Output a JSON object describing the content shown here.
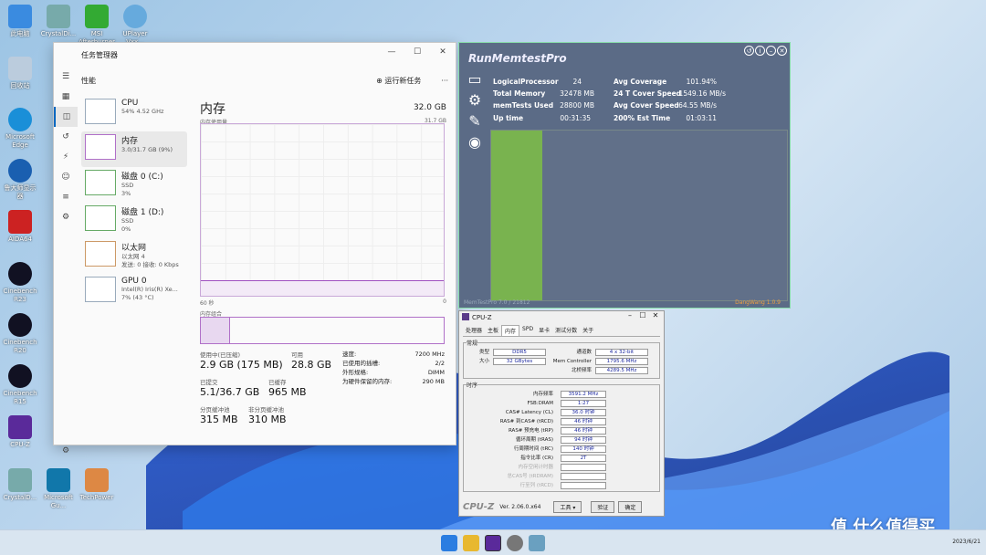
{
  "desktop": {
    "icons": [
      {
        "label": "此电脑",
        "color": "#3a8be0"
      },
      {
        "label": "CrystalDi...",
        "color": "#7aa"
      },
      {
        "label": "MSI\nAfterburner",
        "color": "#3a3"
      },
      {
        "label": "UPlayer\nVxx...",
        "color": "#6ad"
      },
      {
        "label": "回收站",
        "color": "#bcd"
      },
      {
        "label": "Microsoft\nEdge",
        "color": "#1a8fd8"
      },
      {
        "label": "鲁大师显示\n器",
        "color": "#1a5fb0"
      },
      {
        "label": "AIDA64",
        "color": "#c22"
      },
      {
        "label": "Cinebench\nR23",
        "color": "#112"
      },
      {
        "label": "Cinebench\nR20",
        "color": "#112"
      },
      {
        "label": "Cinebench\nR15",
        "color": "#112"
      },
      {
        "label": "CPU-Z",
        "color": "#5a2a9a"
      },
      {
        "label": "CrystalD...",
        "color": "#7aa"
      },
      {
        "label": "Microsoft\nGu...",
        "color": "#17a"
      },
      {
        "label": "TechPower",
        "color": "#d84"
      }
    ]
  },
  "taskmanager": {
    "title": "任务管理器",
    "section": "性能",
    "run_task": "运行新任务",
    "more": "···",
    "items": [
      {
        "name": "CPU",
        "l1": "54% 4.52 GHz",
        "l2": ""
      },
      {
        "name": "内存",
        "l1": "3.0/31.7 GB (9%)",
        "l2": ""
      },
      {
        "name": "磁盘 0 (C:)",
        "l1": "SSD",
        "l2": "3%"
      },
      {
        "name": "磁盘 1 (D:)",
        "l1": "SSD",
        "l2": "0%"
      },
      {
        "name": "以太网",
        "l1": "以太网 4",
        "l2": "发送: 0 接收: 0 Kbps"
      },
      {
        "name": "GPU 0",
        "l1": "Intel(R) Iris(R) Xe...",
        "l2": "7% (43 °C)"
      }
    ],
    "main": {
      "title": "内存",
      "capacity": "32.0 GB",
      "usage_label": "内存使用量",
      "usage_max": "31.7 GB",
      "time_left": "60 秒",
      "time_right": "0",
      "composition_label": "内存组合",
      "usage_fraction": 0.09,
      "composition_used_fraction": 0.12,
      "stats": {
        "in_use_label": "使用中(已压缩)",
        "in_use": "2.9 GB (175 MB)",
        "available_label": "可用",
        "available": "28.8 GB",
        "committed_label": "已提交",
        "committed": "5.1/36.7 GB",
        "cached_label": "已缓存",
        "cached": "965 MB",
        "paged_label": "分页缓冲池",
        "paged": "315 MB",
        "nonpaged_label": "非分页缓冲池",
        "nonpaged": "310 MB"
      },
      "specs": [
        {
          "k": "速度:",
          "v": "7200 MHz"
        },
        {
          "k": "已使用的插槽:",
          "v": "2/2"
        },
        {
          "k": "外形规格:",
          "v": "DIMM"
        },
        {
          "k": "为硬件保留的内存:",
          "v": "290 MB"
        }
      ]
    }
  },
  "runmemtest": {
    "title": "RunMemtestPro",
    "left": [
      {
        "k": "LogicalProcessor",
        "v": "24"
      },
      {
        "k": "Total Memory",
        "v": "32478 MB"
      },
      {
        "k": "memTests Used",
        "v": "28800 MB"
      },
      {
        "k": "Up time",
        "v": "00:31:35"
      }
    ],
    "right": [
      {
        "k": "Avg Coverage",
        "v": "101.94%"
      },
      {
        "k": "24 T Cover Speed",
        "v": "1549.16 MB/s"
      },
      {
        "k": "Avg Cover Speed",
        "v": "64.55 MB/s"
      },
      {
        "k": "200% Est Time",
        "v": "01:03:11"
      }
    ],
    "footer_left": "MemTestPro 7.0 / 21812",
    "footer_right": "DangWang 1.0.9",
    "bar_color": "#79b34f"
  },
  "cpuz": {
    "title": "CPU-Z",
    "tabs": [
      "处理器",
      "主板",
      "内存",
      "SPD",
      "显卡",
      "测试分数",
      "关于"
    ],
    "active_tab": "内存",
    "general_label": "常规",
    "type_k": "类型",
    "type_v": "DDR5",
    "size_k": "大小",
    "size_v": "32 GBytes",
    "channel_k": "通道数",
    "channel_v": "4 x 32-bit",
    "mc_k": "Mem Controller",
    "mc_v": "1795.6 MHz",
    "nb_k": "北桥频率",
    "nb_v": "4289.5 MHz",
    "timing_label": "时序",
    "timings": [
      {
        "k": "内存频率",
        "v": "3591.2 MHz",
        "grey": false
      },
      {
        "k": "FSB:DRAM",
        "v": "1:27",
        "grey": false
      },
      {
        "k": "CAS# Latency (CL)",
        "v": "36.0 时钟",
        "grey": false
      },
      {
        "k": "RAS# 到CAS# (tRCD)",
        "v": "46 时钟",
        "grey": false
      },
      {
        "k": "RAS# 预充电 (tRP)",
        "v": "46 时钟",
        "grey": false
      },
      {
        "k": "循环周期 (tRAS)",
        "v": "94 时钟",
        "grey": false
      },
      {
        "k": "行周期时间 (tRC)",
        "v": "140 时钟",
        "grey": false
      },
      {
        "k": "指令比率 (CR)",
        "v": "2T",
        "grey": false
      },
      {
        "k": "内存空闲计时器",
        "v": "",
        "grey": true
      },
      {
        "k": "总CAS号 (tRDRAM)",
        "v": "",
        "grey": true
      },
      {
        "k": "行至列 (tRCD)",
        "v": "",
        "grey": true
      }
    ],
    "version": "Ver. 2.06.0.x64",
    "tools": "工具",
    "validate": "验证",
    "ok": "确定",
    "brand": "CPU-Z"
  },
  "taskbar": {
    "date": "2023/6/21"
  },
  "watermark": "值 什么值得买"
}
